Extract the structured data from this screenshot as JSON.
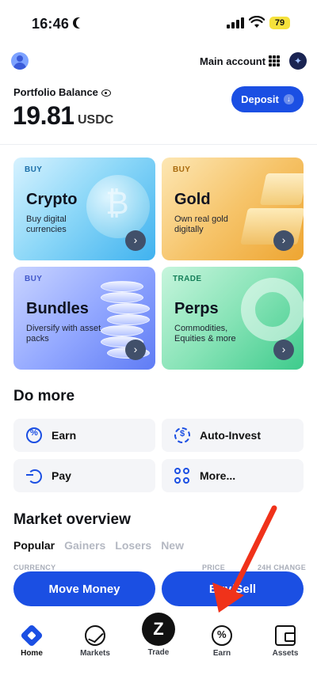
{
  "status_bar": {
    "time": "16:46",
    "battery": "79"
  },
  "header": {
    "account_label": "Main account",
    "icons": {
      "avatar": "user-avatar-icon",
      "apps": "grid-icon",
      "assistant": "sparkle-icon"
    }
  },
  "balance": {
    "label": "Portfolio Balance",
    "value": "19.81",
    "currency": "USDC",
    "deposit_label": "Deposit"
  },
  "cards": [
    {
      "tag": "BUY",
      "title": "Crypto",
      "subtitle": "Buy digital currencies"
    },
    {
      "tag": "BUY",
      "title": "Gold",
      "subtitle": "Own real gold digitally"
    },
    {
      "tag": "BUY",
      "title": "Bundles",
      "subtitle": "Diversify with asset packs"
    },
    {
      "tag": "TRADE",
      "title": "Perps",
      "subtitle": "Commodities, Equities & more"
    }
  ],
  "do_more": {
    "title": "Do more",
    "actions": [
      {
        "label": "Earn"
      },
      {
        "label": "Auto-Invest"
      },
      {
        "label": "Pay"
      },
      {
        "label": "More..."
      }
    ]
  },
  "market_overview": {
    "title": "Market overview",
    "tabs": [
      "Popular",
      "Gainers",
      "Losers",
      "New"
    ],
    "columns": {
      "currency": "CURRENCY",
      "price": "PRICE",
      "change": "24H CHANGE"
    }
  },
  "buttons": {
    "move_money": "Move Money",
    "buy_sell": "Buy/Sell"
  },
  "nav": {
    "items": [
      {
        "label": "Home"
      },
      {
        "label": "Markets"
      },
      {
        "label": "Trade"
      },
      {
        "label": "Earn"
      },
      {
        "label": "Assets"
      }
    ],
    "active": "Home"
  },
  "colors": {
    "brand_blue": "#1b4fe3",
    "annotation_red": "#f0321a"
  }
}
